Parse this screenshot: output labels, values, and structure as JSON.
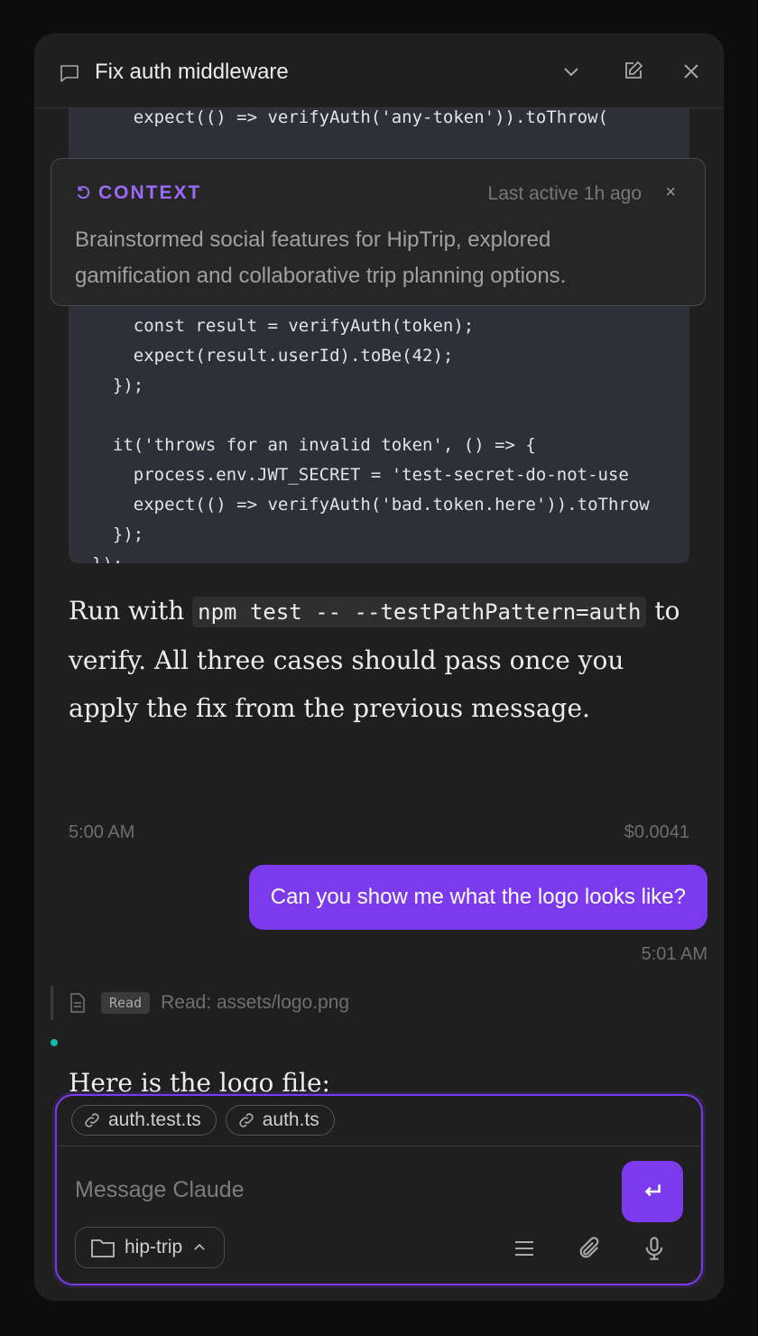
{
  "header": {
    "title": "Fix auth middleware"
  },
  "code": {
    "lines": [
      "    expect(() => verifyAuth('any-token')).toThrow(",
      "",
      "",
      "",
      "",
      "",
      "",
      "    const result = verifyAuth(token);",
      "    expect(result.userId).toBe(42);",
      "  });",
      "",
      "  it('throws for an invalid token', () => {",
      "    process.env.JWT_SECRET = 'test-secret-do-not-use",
      "    expect(() => verifyAuth('bad.token.here')).toThrow",
      "  });",
      "});"
    ]
  },
  "context": {
    "title": "CONTEXT",
    "time": "Last active 1h ago",
    "close": "×",
    "body": "Brainstormed social features for HipTrip, explored gamification and collaborative trip planning options."
  },
  "assistant_message": {
    "text_before": "Run with ",
    "code_1": "npm test -- --testPathPattern=auth",
    "text_after": " to verify. All three cases should pass once you apply the fix from the previous message.",
    "time": "5:00 AM",
    "cost": "$0.0041"
  },
  "user_message": {
    "text": "Can you show me what the logo looks like?",
    "time": "5:01 AM"
  },
  "tool_call": {
    "badge": "Read",
    "text": "Read: assets/logo.png"
  },
  "assistant_reply": {
    "text": "Here is the logo file:"
  },
  "composer": {
    "chips": [
      "auth.test.ts",
      "auth.ts"
    ],
    "placeholder": "Message Claude",
    "project": "hip-trip"
  },
  "colors": {
    "accent": "#7c3aed",
    "context_title": "#9b6bf5",
    "status_dot": "#14b8a6"
  },
  "icons": [
    "chat-icon",
    "chevron-down-icon",
    "edit-icon",
    "close-icon",
    "refresh-icon",
    "file-icon",
    "link-icon",
    "enter-icon",
    "folder-icon",
    "chevron-up-icon",
    "list-icon",
    "paperclip-icon",
    "microphone-icon"
  ]
}
